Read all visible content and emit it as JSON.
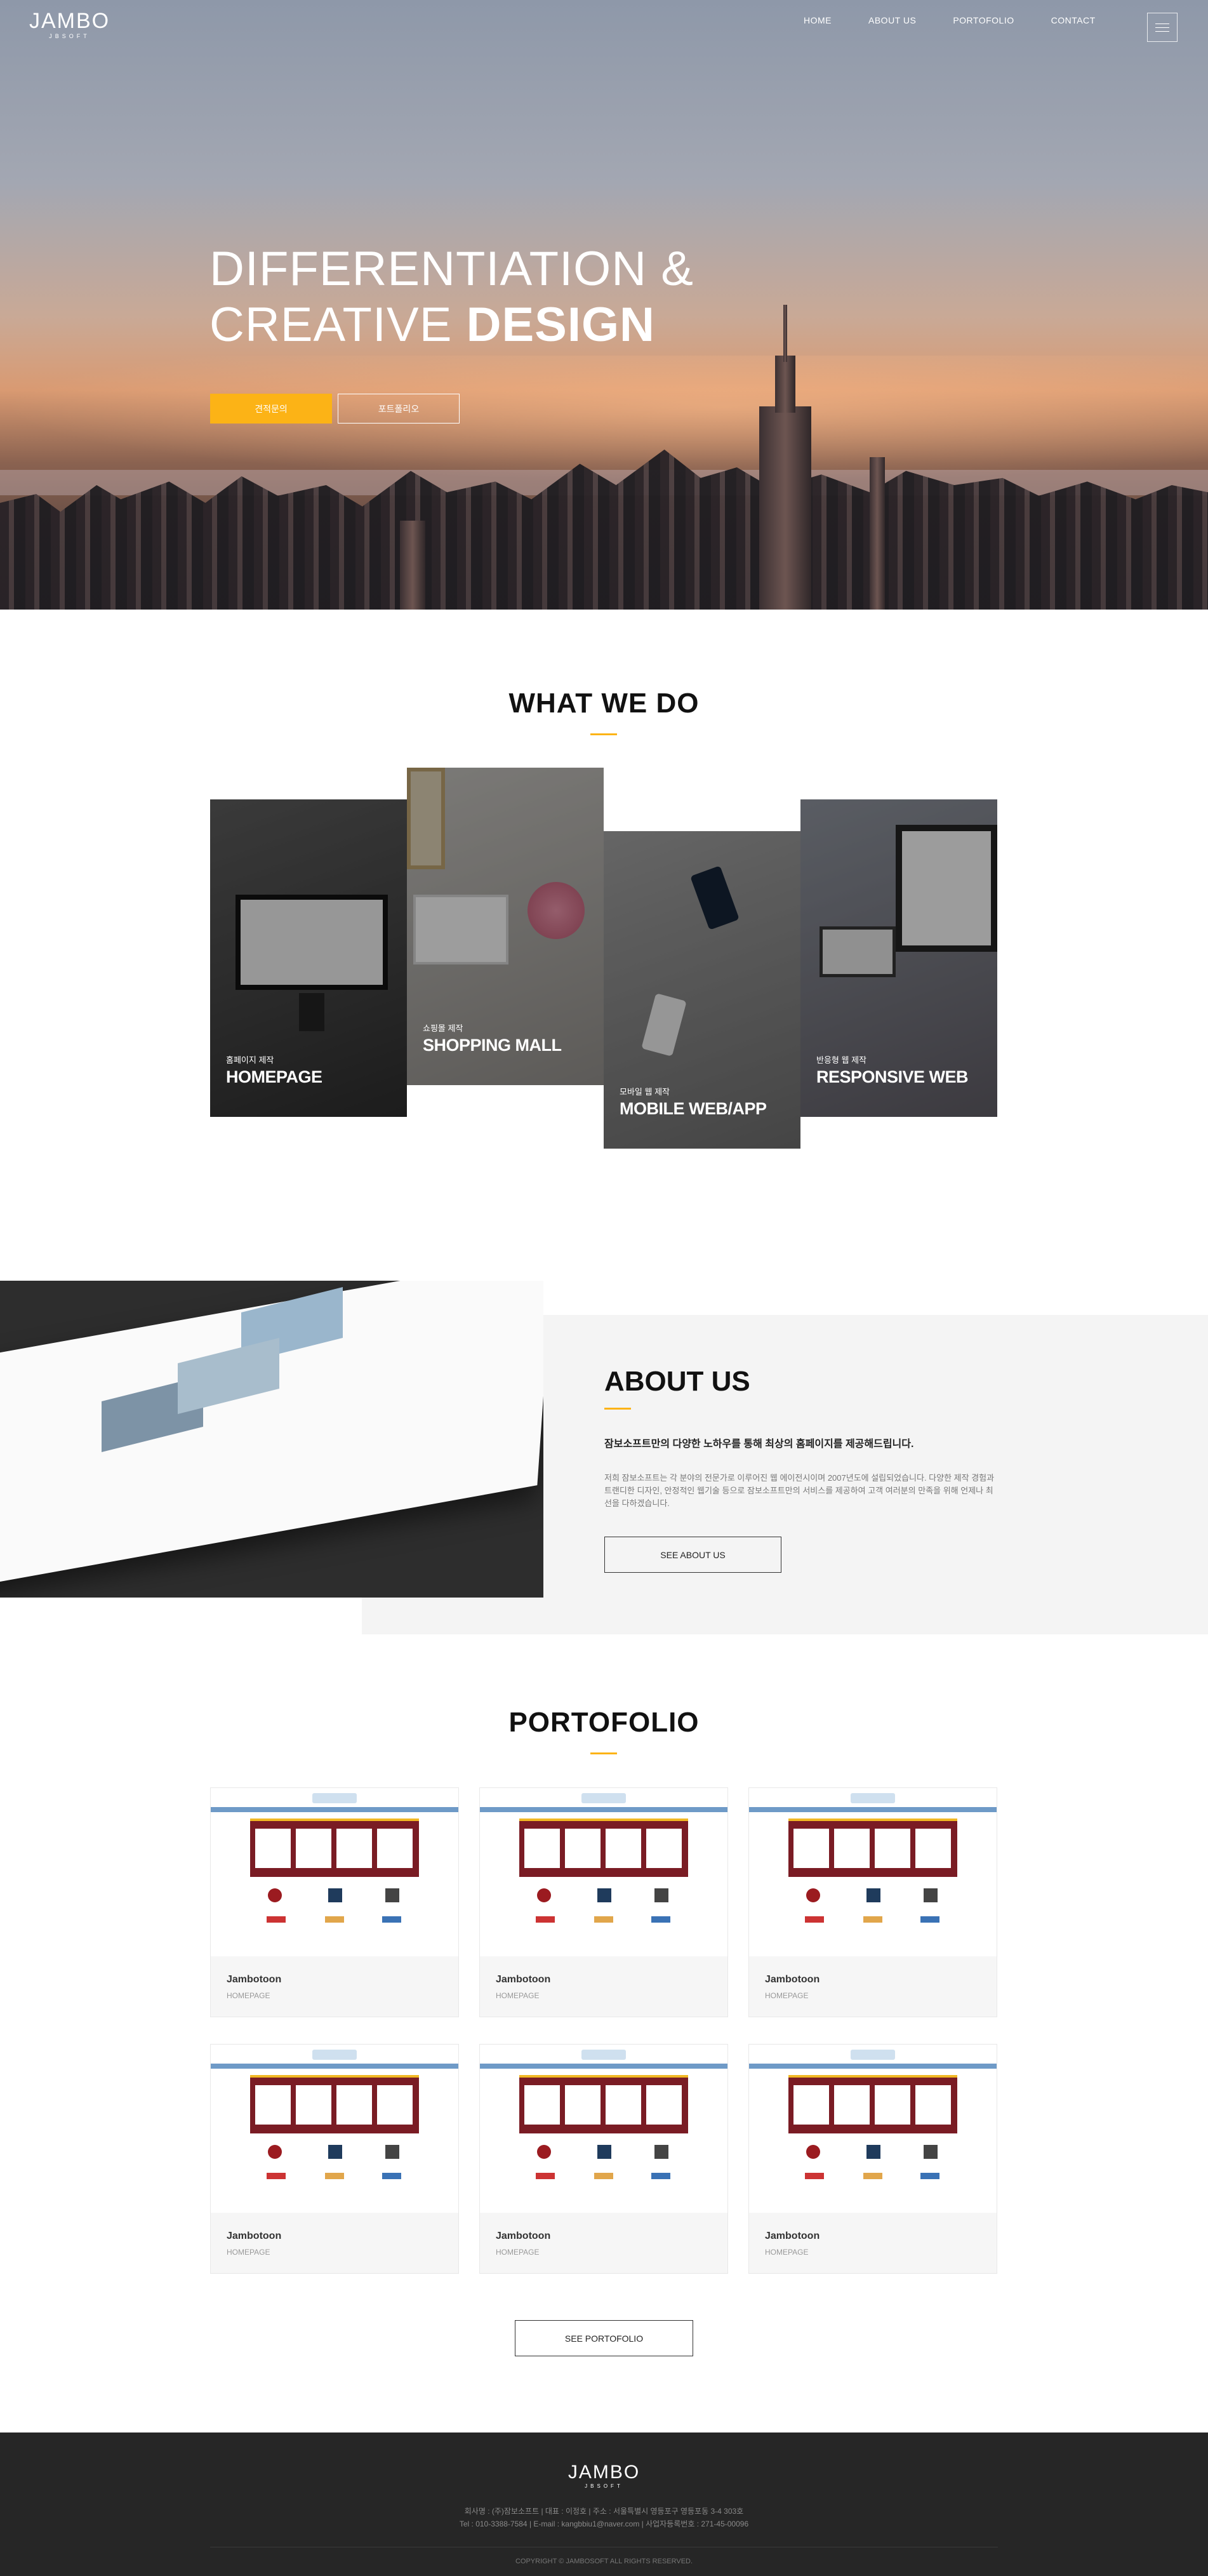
{
  "header": {
    "logo_main": "JAMBO",
    "logo_sub": "JBSOFT",
    "nav": [
      "HOME",
      "ABOUT US",
      "PORTOFOLIO",
      "CONTACT"
    ]
  },
  "hero": {
    "line1": "DIFFERENTIATION &",
    "line2_light": "CREATIVE ",
    "line2_bold": "DESIGN",
    "btn_quote": "견적문의",
    "btn_portfolio": "포트폴리오"
  },
  "what_we_do": {
    "title": "WHAT WE DO",
    "cards": [
      {
        "sub": "홈페이지 제작",
        "main": "HOMEPAGE"
      },
      {
        "sub": "쇼핑몰 제작",
        "main": "SHOPPING MALL"
      },
      {
        "sub": "모바일 웹 제작",
        "main": "MOBILE WEB/APP"
      },
      {
        "sub": "반응형 웹 제작",
        "main": "RESPONSIVE WEB"
      }
    ]
  },
  "about": {
    "title": "ABOUT US",
    "lead": "잠보소프트만의 다양한 노하우를 통해 최상의 홈페이지를 제공해드립니다.",
    "desc": "저희 잠보소프트는 각 분야의 전문가로 이루어진 웹 에이전시이며 2007년도에 설립되었습니다. 다양한 제작 경험과 트랜디한 디자인, 안정적인 웹기술 등으로 잠보소프트만의 서비스를 제공하여 고객 여러분의 만족을 위해 언제나 최선을 다하겠습니다.",
    "button": "SEE ABOUT US"
  },
  "portfolio": {
    "title": "PORTOFOLIO",
    "items": [
      {
        "name": "Jambotoon",
        "category": "HOMEPAGE"
      },
      {
        "name": "Jambotoon",
        "category": "HOMEPAGE"
      },
      {
        "name": "Jambotoon",
        "category": "HOMEPAGE"
      },
      {
        "name": "Jambotoon",
        "category": "HOMEPAGE"
      },
      {
        "name": "Jambotoon",
        "category": "HOMEPAGE"
      },
      {
        "name": "Jambotoon",
        "category": "HOMEPAGE"
      }
    ],
    "button": "SEE PORTOFOLIO"
  },
  "footer": {
    "logo_main": "JAMBO",
    "logo_sub": "JBSOFT",
    "info_line1": "회사명 : (주)잠보소프트  |  대표 : 이정호  |  주소 : 서울특별시 영등포구 영등포동 3-4 303호",
    "info_line2": "Tel : 010-3388-7584  |  E-mail : kangbbiu1@naver.com  |  사업자등록번호 : 271-45-00096",
    "copyright": "COPYRIGHT © JAMBOSOFT ALL RIGHTS RESERVED."
  },
  "colors": {
    "accent": "#fcb316",
    "footer_bg": "#262626",
    "about_bg": "#f4f4f4"
  }
}
